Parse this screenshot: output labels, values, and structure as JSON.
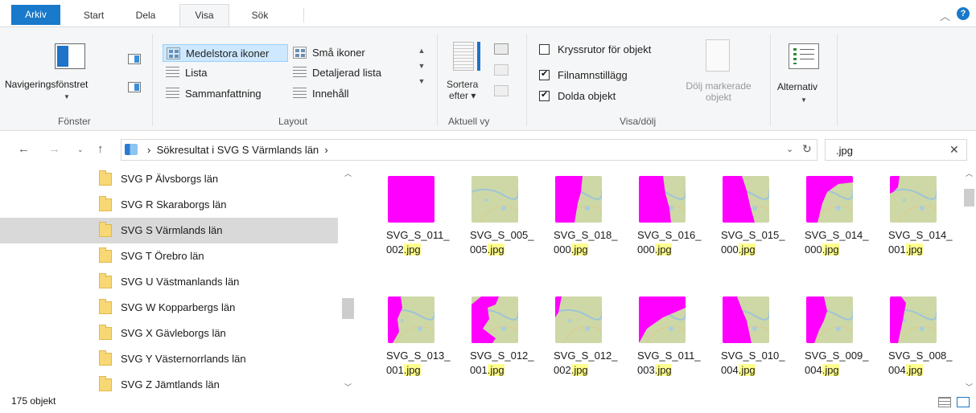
{
  "tabs": {
    "arkiv": "Arkiv",
    "start": "Start",
    "dela": "Dela",
    "visa": "Visa",
    "sok": "Sök"
  },
  "ribbon": {
    "navpane": "Navigeringsfönstret",
    "fonster_label": "Fönster",
    "layout_label": "Layout",
    "layout_options": {
      "medelstora": "Medelstora ikoner",
      "sma": "Små ikoner",
      "lista": "Lista",
      "detaljerad": "Detaljerad lista",
      "sammanfattning": "Sammanfattning",
      "innehall": "Innehåll"
    },
    "sortera": "Sortera",
    "efter": "efter",
    "aktuell_label": "Aktuell vy",
    "kryssrutor": "Kryssrutor för objekt",
    "filnamn": "Filnamnstillägg",
    "dolda": "Dolda objekt",
    "dolj1": "Dölj markerade",
    "dolj2": "objekt",
    "visadolj_label": "Visa/dölj",
    "alternativ": "Alternativ"
  },
  "address": {
    "path": "Sökresultat i SVG S Värmlands län",
    "sep": "›",
    "search_value": ".jpg"
  },
  "tree": [
    "SVG P Älvsborgs län",
    "SVG R Skaraborgs län",
    "SVG S Värmlands län",
    "SVG T Örebro län",
    "SVG U Västmanlands län",
    "SVG W Kopparbergs län",
    "SVG X Gävleborgs län",
    "SVG Y Västernorrlands län",
    "SVG Z Jämtlands län"
  ],
  "files": [
    {
      "name": "SVG_S_011_002",
      "ext": ".jpg"
    },
    {
      "name": "SVG_S_005_005",
      "ext": ".jpg"
    },
    {
      "name": "SVG_S_018_000",
      "ext": ".jpg"
    },
    {
      "name": "SVG_S_016_000",
      "ext": ".jpg"
    },
    {
      "name": "SVG_S_015_000",
      "ext": ".jpg"
    },
    {
      "name": "SVG_S_014_000",
      "ext": ".jpg"
    },
    {
      "name": "SVG_S_014_001",
      "ext": ".jpg"
    },
    {
      "name": "SVG_S_013_001",
      "ext": ".jpg"
    },
    {
      "name": "SVG_S_012_001",
      "ext": ".jpg"
    },
    {
      "name": "SVG_S_012_002",
      "ext": ".jpg"
    },
    {
      "name": "SVG_S_011_003",
      "ext": ".jpg"
    },
    {
      "name": "SVG_S_010_004",
      "ext": ".jpg"
    },
    {
      "name": "SVG_S_009_004",
      "ext": ".jpg"
    },
    {
      "name": "SVG_S_008_004",
      "ext": ".jpg"
    }
  ],
  "status": {
    "count": "175 objekt"
  },
  "colors": {
    "accent": "#1979ca",
    "magenta": "#ff00ff",
    "map_green": "#c8d7a3",
    "selection": "#cde8ff",
    "highlight": "#ffff8e"
  }
}
